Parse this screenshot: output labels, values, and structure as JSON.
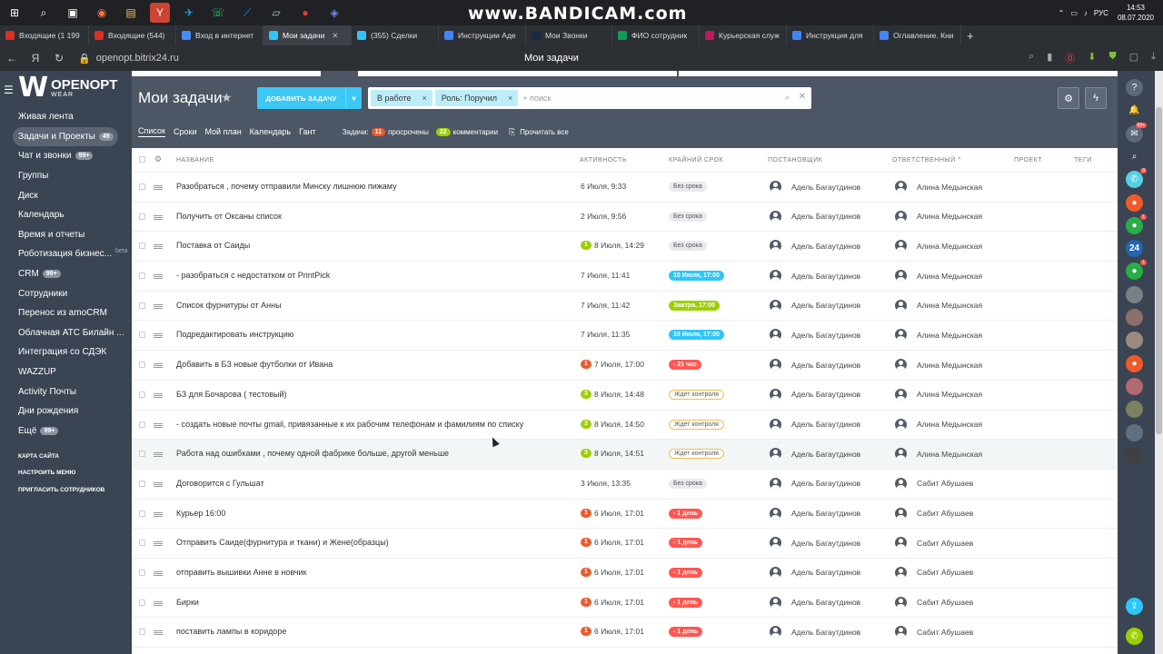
{
  "watermark": "www.BANDICAM.com",
  "taskbar": {
    "icons": [
      "windows-icon",
      "search-icon",
      "taskview-icon",
      "firefox-icon",
      "explorer-icon",
      "yandex-icon",
      "telegram-icon",
      "whatsapp-icon",
      "app-icon",
      "notes-icon",
      "record-icon",
      "discord-icon"
    ]
  },
  "tray": {
    "lang": "РУС",
    "time": "14:53",
    "date": "08.07.2020"
  },
  "browser": {
    "tabs": [
      {
        "label": "Входящие (1 199",
        "fav": "#d93025"
      },
      {
        "label": "Входящие (544)",
        "fav": "#d93025"
      },
      {
        "label": "Вход в интернет",
        "fav": "#4a8af4"
      },
      {
        "label": "Мои задачи",
        "fav": "#2fc6f6",
        "active": true
      },
      {
        "label": "(355) Сделки",
        "fav": "#2fc6f6"
      },
      {
        "label": "Инструкции Аде",
        "fav": "#4285f4"
      },
      {
        "label": "Мои Звонки",
        "fav": "#1b2a44"
      },
      {
        "label": "ФИО сотрудник",
        "fav": "#0f9d58"
      },
      {
        "label": "Курьерская служ",
        "fav": "#c2185b"
      },
      {
        "label": "Инструкция для",
        "fav": "#4285f4"
      },
      {
        "label": "Оглавление. Кни",
        "fav": "#4285f4"
      }
    ],
    "url": "openopt.bitrix24.ru",
    "page_title": "Мои задачи"
  },
  "logo": {
    "name": "OPENOPT",
    "sub": "WEAR"
  },
  "menu": [
    {
      "label": "Живая лента"
    },
    {
      "label": "Задачи и Проекты",
      "badge": "49",
      "active": true
    },
    {
      "label": "Чат и звонки",
      "badge": "99+"
    },
    {
      "label": "Группы"
    },
    {
      "label": "Диск"
    },
    {
      "label": "Календарь"
    },
    {
      "label": "Время и отчеты"
    },
    {
      "label": "Роботизация бизнес...",
      "beta": "beta"
    },
    {
      "label": "CRM",
      "badge": "99+"
    },
    {
      "label": "Сотрудники"
    },
    {
      "label": "Перенос из amoCRM"
    },
    {
      "label": "Облачная АТС Билайн ..."
    },
    {
      "label": "Интеграция со СДЭК"
    },
    {
      "label": "WAZZUP"
    },
    {
      "label": "Activity Почты"
    },
    {
      "label": "Дни рождения"
    },
    {
      "label": "Ещё",
      "badge": "99+"
    }
  ],
  "menu_settings": [
    "КАРТА САЙТА",
    "НАСТРОИТЬ МЕНЮ",
    "ПРИГЛАСИТЬ СОТРУДНИКОВ"
  ],
  "header": {
    "title": "Мои задачи",
    "add_label": "ДОБАВИТЬ ЗАДАЧУ"
  },
  "filter": {
    "chips": [
      "В работе",
      "Роль: Поручил"
    ],
    "placeholder": "+ поиск"
  },
  "views": {
    "items": [
      "Список",
      "Сроки",
      "Мой план",
      "Календарь",
      "Гант"
    ],
    "tasks_label": "Задачи:",
    "overdue_count": "11",
    "overdue_label": "просрочены",
    "comments_count": "22",
    "comments_label": "комментарии",
    "read_all": "Прочитать все"
  },
  "columns": {
    "name": "НАЗВАНИЕ",
    "activity": "АКТИВНОСТЬ",
    "deadline": "КРАЙНИЙ СРОК",
    "creator": "ПОСТАНОВЩИК",
    "responsible": "ОТВЕТСТВЕННЫЙ ^",
    "project": "ПРОЕКТ",
    "tags": "ТЕГИ"
  },
  "colors": {
    "blue": "#2fc6f6",
    "green": "#9dcf00",
    "red": "#ff5752",
    "yellow": "#ebbf48",
    "counter_red": "#f05a2a",
    "counter_green": "#9dcf00"
  },
  "tasks": [
    {
      "name": "Разобраться , почему отправили Минску лишнюю пижаму",
      "activity": "6 Июля, 9:33",
      "deadline": "Без срока",
      "dl_type": "gray",
      "creator": "Адель Багаутдинов",
      "responsible": "Алина Медынская"
    },
    {
      "name": "Получить от Оксаны список",
      "activity": "2 Июля, 9:56",
      "deadline": "Без срока",
      "dl_type": "gray",
      "creator": "Адель Багаутдинов",
      "responsible": "Алина Медынская"
    },
    {
      "name": "Поставка от Саиды",
      "activity": "8 Июля, 14:29",
      "counter": "1",
      "counter_color": "green",
      "deadline": "Без срока",
      "dl_type": "gray",
      "creator": "Адель Багаутдинов",
      "responsible": "Алина Медынская"
    },
    {
      "name": "- разобраться с недостатком от PrintPick",
      "activity": "7 Июля, 11:41",
      "deadline": "10 Июля, 17:00",
      "dl_type": "blue",
      "creator": "Адель Багаутдинов",
      "responsible": "Алина Медынская"
    },
    {
      "name": "Список фурнитуры от Анны",
      "activity": "7 Июля, 11:42",
      "deadline": "Завтра, 17:00",
      "dl_type": "green",
      "creator": "Адель Багаутдинов",
      "responsible": "Алина Медынская"
    },
    {
      "name": "Подредактировать инструкцию",
      "activity": "7 Июля, 11:35",
      "deadline": "10 Июля, 17:00",
      "dl_type": "blue",
      "creator": "Адель Багаутдинов",
      "responsible": "Алина Медынская"
    },
    {
      "name": "Добавить в БЗ новые футболки от Ивана",
      "activity": "7 Июля, 17:00",
      "counter": "1",
      "counter_color": "red",
      "deadline": "- 21 час",
      "dl_type": "red",
      "creator": "Адель Багаутдинов",
      "responsible": "Алина Медынская"
    },
    {
      "name": "БЗ для Бочарова ( тестовый)",
      "activity": "8 Июля, 14:48",
      "counter": "3",
      "counter_color": "green",
      "deadline": "Ждет контроля",
      "dl_type": "yel",
      "creator": "Адель Багаутдинов",
      "responsible": "Алина Медынская"
    },
    {
      "name": "- создать новые почты gmail, привязанные к их рабочим телефонам и фамилиям по списку",
      "activity": "8 Июля, 14:50",
      "counter": "3",
      "counter_color": "green",
      "deadline": "Ждет контроля",
      "dl_type": "yel",
      "creator": "Адель Багаутдинов",
      "responsible": "Алина Медынская"
    },
    {
      "name": "Работа над ошибками , почему одной фабрике больше, другой меньше",
      "activity": "8 Июля, 14:51",
      "counter": "3",
      "counter_color": "green",
      "deadline": "Ждет контроля",
      "dl_type": "yel",
      "creator": "Адель Багаутдинов",
      "responsible": "Алина Медынская",
      "highlight": true
    },
    {
      "name": "Договорится с Гульшат",
      "activity": "3 Июля, 13:35",
      "deadline": "Без срока",
      "dl_type": "gray",
      "creator": "Адель Багаутдинов",
      "responsible": "Сабит Абушаев",
      "photo": true
    },
    {
      "name": "Курьер 16:00",
      "activity": "6 Июля, 17:01",
      "counter": "1",
      "counter_color": "red",
      "deadline": "- 1 день",
      "dl_type": "red",
      "creator": "Адель Багаутдинов",
      "responsible": "Сабит Абушаев",
      "photo": true
    },
    {
      "name": "Отправить Саиде(фурнитура и ткани) и Жене(образцы)",
      "activity": "6 Июля, 17:01",
      "counter": "1",
      "counter_color": "red",
      "deadline": "- 1 день",
      "dl_type": "red",
      "creator": "Адель Багаутдинов",
      "responsible": "Сабит Абушаев",
      "photo": true
    },
    {
      "name": "отправить вышивки Анне в новчик",
      "activity": "6 Июля, 17:01",
      "counter": "1",
      "counter_color": "red",
      "deadline": "- 1 день",
      "dl_type": "red",
      "creator": "Адель Багаутдинов",
      "responsible": "Сабит Абушаев",
      "photo": true
    },
    {
      "name": "Бирки",
      "activity": "6 Июля, 17:01",
      "counter": "1",
      "counter_color": "red",
      "deadline": "- 1 день",
      "dl_type": "red",
      "creator": "Адель Багаутдинов",
      "responsible": "Сабит Абушаев",
      "photo": true
    },
    {
      "name": "поставить лампы в коридоре",
      "activity": "6 Июля, 17:01",
      "counter": "1",
      "counter_color": "red",
      "deadline": "- 1 день",
      "dl_type": "red",
      "creator": "Адель Багаутдинов",
      "responsible": "Сабит Абушаев",
      "photo": true
    }
  ],
  "rightbar": [
    {
      "icon": "help-icon",
      "color": "#5d6878"
    },
    {
      "icon": "bell-icon",
      "color": "transparent"
    },
    {
      "icon": "chat-icon",
      "color": "#5d6878",
      "badge": "99+"
    },
    {
      "icon": "search-icon",
      "color": "transparent"
    },
    {
      "icon": "phone-icon",
      "color": "#55d0e0",
      "badge": "3"
    },
    {
      "icon": "user-icon",
      "color": "#f05a2a"
    },
    {
      "icon": "user-icon",
      "color": "#29ad49",
      "badge": "1"
    },
    {
      "icon": "bitrix24-icon",
      "color": "#2067b0",
      "text": "24"
    },
    {
      "icon": "user-icon",
      "color": "#29ad49",
      "badge": "1"
    },
    {
      "icon": "avatar-icon",
      "color": "#7a7f88"
    },
    {
      "icon": "avatar-icon",
      "color": "#8a6f6a"
    },
    {
      "icon": "avatar-icon",
      "color": "#9a8a80"
    },
    {
      "icon": "user-icon",
      "color": "#f05a2a"
    },
    {
      "icon": "avatar-icon",
      "color": "#b06a70"
    },
    {
      "icon": "avatar-icon",
      "color": "#7a8060"
    },
    {
      "icon": "avatar-icon",
      "color": "#607080"
    },
    {
      "icon": "avatar-icon",
      "color": "#404040"
    }
  ]
}
